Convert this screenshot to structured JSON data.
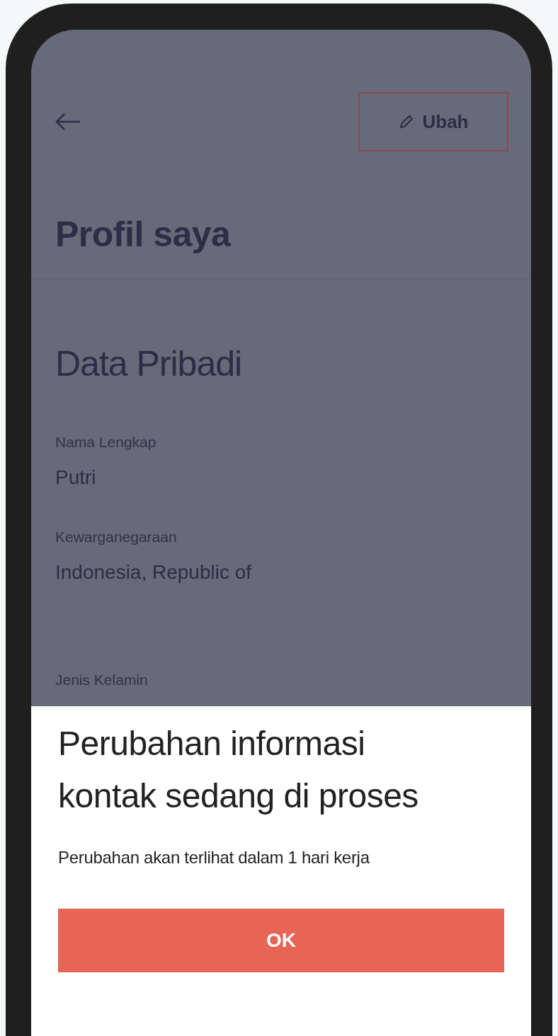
{
  "header": {
    "edit_button": {
      "label": "Ubah"
    }
  },
  "title": "Profil saya",
  "section": {
    "title": "Data Pribadi",
    "fields": [
      {
        "label": "Nama Lengkap",
        "value": "Putri"
      },
      {
        "label": "Kewarganegaraan",
        "value": "Indonesia, Republic of"
      },
      {
        "label": "Jenis Kelamin"
      }
    ]
  },
  "sheet": {
    "title": "Perubahan informasi kontak sedang di proses",
    "message": "Perubahan akan terlihat dalam 1 hari kerja",
    "button": "OK"
  }
}
